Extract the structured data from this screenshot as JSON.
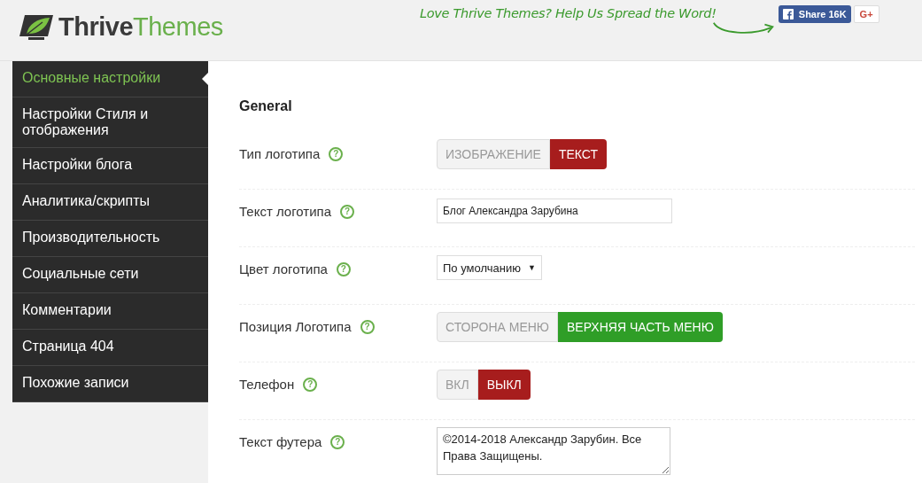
{
  "header": {
    "logo": {
      "word_1": "Thrive",
      "word_2": "Themes"
    },
    "promo": "Love Thrive Themes? Help Us Spread the Word!",
    "share_button": "Share 16K",
    "gplus_button": "G+"
  },
  "sidebar": {
    "items": [
      {
        "label": "Основные настройки",
        "selected": true
      },
      {
        "label": "Настройки Стиля и отображения",
        "selected": false
      },
      {
        "label": "Настройки блога",
        "selected": false
      },
      {
        "label": "Аналитика/скрипты",
        "selected": false
      },
      {
        "label": "Производительность",
        "selected": false
      },
      {
        "label": "Социальные сети",
        "selected": false
      },
      {
        "label": "Комментарии",
        "selected": false
      },
      {
        "label": "Страница 404",
        "selected": false
      },
      {
        "label": "Похожие записи",
        "selected": false
      }
    ]
  },
  "section": {
    "title": "General",
    "rows": [
      {
        "kind": "toggle",
        "label": "Тип логотипа",
        "help": "?",
        "color": "#a71d1d",
        "options": [
          {
            "label": "ИЗОБРАЖЕНИЕ",
            "selected": false
          },
          {
            "label": "ТЕКСТ",
            "selected": true
          }
        ]
      },
      {
        "kind": "text",
        "label": "Текст логотипа",
        "help": "?",
        "value": "Блог Александра Зарубина"
      },
      {
        "kind": "select",
        "label": "Цвет логотипа",
        "help": "?",
        "value": "По умолчанию",
        "caret": "▼"
      },
      {
        "kind": "toggle",
        "label": "Позиция Логотипа",
        "help": "?",
        "color": "#2f9e27",
        "options": [
          {
            "label": "СТОРОНА МЕНЮ",
            "selected": false
          },
          {
            "label": "ВЕРХНЯЯ ЧАСТЬ МЕНЮ",
            "selected": true
          }
        ]
      },
      {
        "kind": "toggle",
        "label": "Телефон",
        "help": "?",
        "color": "#a71d1d",
        "options": [
          {
            "label": "ВКЛ",
            "selected": false
          },
          {
            "label": "ВЫКЛ",
            "selected": true
          }
        ]
      },
      {
        "kind": "textarea",
        "label": "Текст футера",
        "help": "?",
        "value": "©2014-2018 Александр Зарубин. Все Права Защищены."
      }
    ]
  }
}
